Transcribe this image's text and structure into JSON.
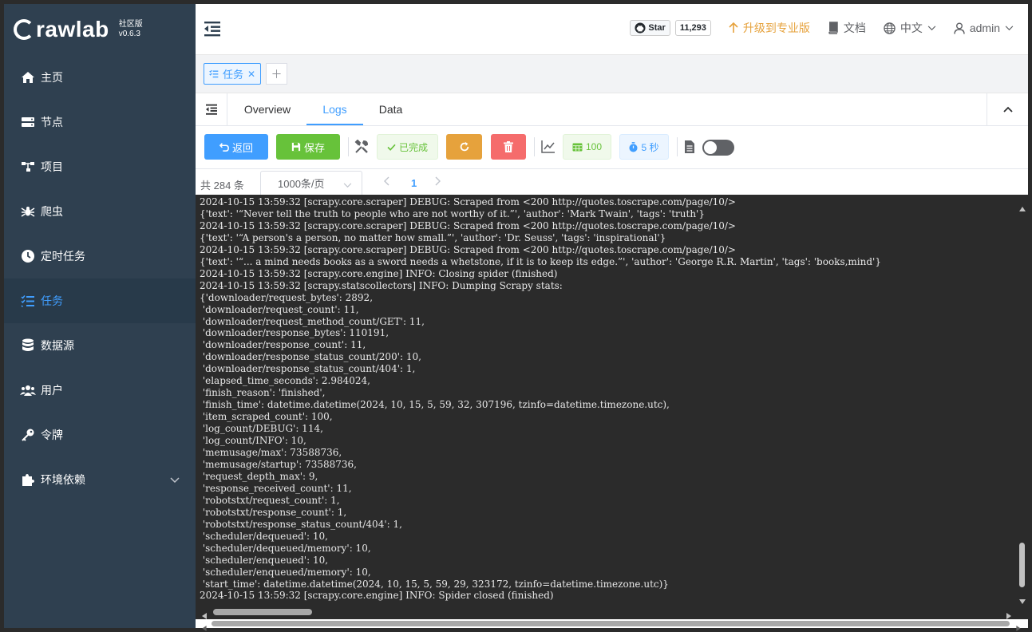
{
  "brand": {
    "name": "rawlab",
    "edition": "社区版",
    "version": "v0.6.3"
  },
  "sidebar": {
    "items": [
      {
        "label": "主页",
        "icon": "home-icon"
      },
      {
        "label": "节点",
        "icon": "server-icon"
      },
      {
        "label": "项目",
        "icon": "project-tree-icon"
      },
      {
        "label": "爬虫",
        "icon": "spider-icon"
      },
      {
        "label": "定时任务",
        "icon": "clock-icon"
      },
      {
        "label": "任务",
        "icon": "tasks-icon",
        "active": true
      },
      {
        "label": "数据源",
        "icon": "database-icon"
      },
      {
        "label": "用户",
        "icon": "users-icon"
      },
      {
        "label": "令牌",
        "icon": "key-icon"
      },
      {
        "label": "环境依赖",
        "icon": "puzzle-icon"
      }
    ]
  },
  "header": {
    "github_star": "Star",
    "github_count": "11,293",
    "upgrade": "升级到专业版",
    "docs": "文档",
    "language": "中文",
    "user": "admin"
  },
  "tabs": {
    "open_tab": "任务"
  },
  "nav": {
    "tabs": [
      "Overview",
      "Logs",
      "Data"
    ],
    "active": "Logs"
  },
  "toolbar": {
    "back": "返回",
    "save": "保存",
    "status": "已完成",
    "results": "100",
    "duration": "5 秒"
  },
  "pagination": {
    "total": "共 284 条",
    "page_size": "1000条/页",
    "current_page": "1"
  },
  "log_lines": [
    "2024-10-15 13:59:32 [scrapy.core.scraper] DEBUG: Scraped from <200 http://quotes.toscrape.com/page/10/>",
    "{'text': '“Never tell the truth to people who are not worthy of it.”', 'author': 'Mark Twain', 'tags': 'truth'}",
    "2024-10-15 13:59:32 [scrapy.core.scraper] DEBUG: Scraped from <200 http://quotes.toscrape.com/page/10/>",
    "{'text': '“A person's a person, no matter how small.”', 'author': 'Dr. Seuss', 'tags': 'inspirational'}",
    "2024-10-15 13:59:32 [scrapy.core.scraper] DEBUG: Scraped from <200 http://quotes.toscrape.com/page/10/>",
    "{'text': '“... a mind needs books as a sword needs a whetstone, if it is to keep its edge.”', 'author': 'George R.R. Martin', 'tags': 'books,mind'}",
    "2024-10-15 13:59:32 [scrapy.core.engine] INFO: Closing spider (finished)",
    "2024-10-15 13:59:32 [scrapy.statscollectors] INFO: Dumping Scrapy stats:",
    "{'downloader/request_bytes': 2892,",
    " 'downloader/request_count': 11,",
    " 'downloader/request_method_count/GET': 11,",
    " 'downloader/response_bytes': 110191,",
    " 'downloader/response_count': 11,",
    " 'downloader/response_status_count/200': 10,",
    " 'downloader/response_status_count/404': 1,",
    " 'elapsed_time_seconds': 2.984024,",
    " 'finish_reason': 'finished',",
    " 'finish_time': datetime.datetime(2024, 10, 15, 5, 59, 32, 307196, tzinfo=datetime.timezone.utc),",
    " 'item_scraped_count': 100,",
    " 'log_count/DEBUG': 114,",
    " 'log_count/INFO': 10,",
    " 'memusage/max': 73588736,",
    " 'memusage/startup': 73588736,",
    " 'request_depth_max': 9,",
    " 'response_received_count': 11,",
    " 'robotstxt/request_count': 1,",
    " 'robotstxt/response_count': 1,",
    " 'robotstxt/response_status_count/404': 1,",
    " 'scheduler/dequeued': 10,",
    " 'scheduler/dequeued/memory': 10,",
    " 'scheduler/enqueued': 10,",
    " 'scheduler/enqueued/memory': 10,",
    " 'start_time': datetime.datetime(2024, 10, 15, 5, 59, 29, 323172, tzinfo=datetime.timezone.utc)}",
    "2024-10-15 13:59:32 [scrapy.core.engine] INFO: Spider closed (finished)"
  ]
}
